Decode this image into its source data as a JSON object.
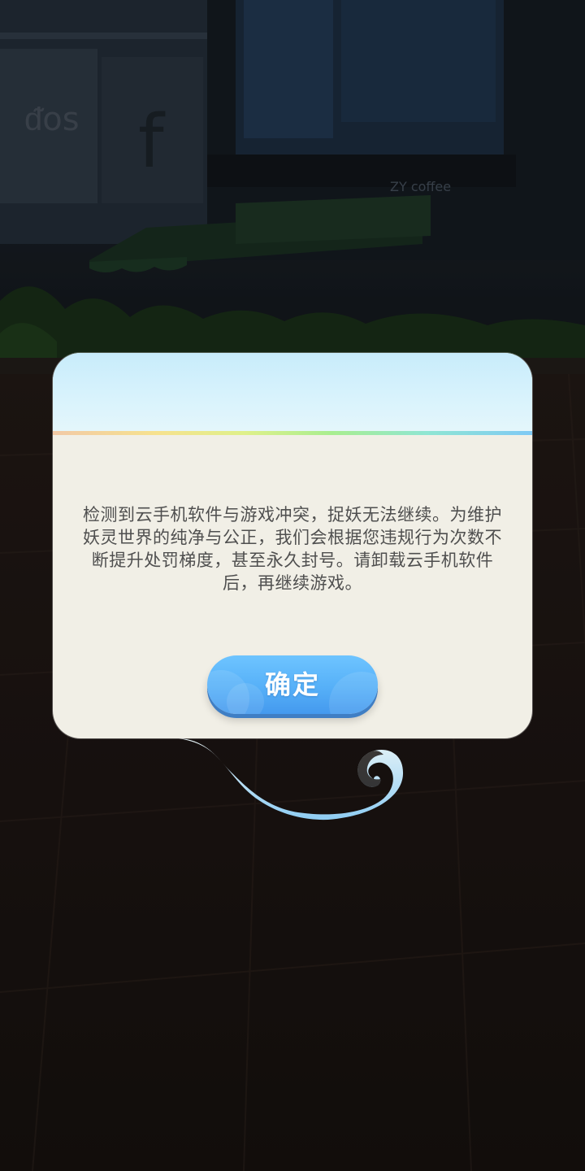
{
  "background": {
    "description_icon": "game-scene-background",
    "storefront_sign": "ZY coffee"
  },
  "dialog": {
    "message": "检测到云手机软件与游戏冲突，捉妖无法继续。为维护妖灵世界的纯净与公正，我们会根据您违规行为次数不断提升处罚梯度，甚至永久封号。请卸载云手机软件后，再继续游戏。",
    "confirm_label": "确定"
  },
  "colors": {
    "dialog_body": "#f1efe6",
    "dialog_header": "#d3f0fb",
    "button": "#56b0f8",
    "text": "#4f4f4f"
  }
}
